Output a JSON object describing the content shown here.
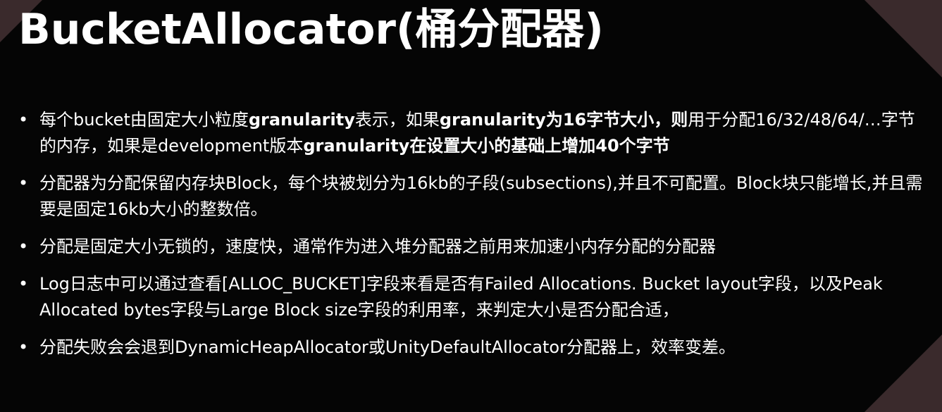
{
  "title": "BucketAllocator(桶分配器)",
  "bullets": [
    {
      "segments": [
        {
          "text": "每个bucket由固定大小粒度",
          "bold": false
        },
        {
          "text": "granularity",
          "bold": true
        },
        {
          "text": "表示，如果",
          "bold": false
        },
        {
          "text": "granularity为16字节大小，则",
          "bold": true
        },
        {
          "text": "用于分配16/32/48/64/…字节的内存，如果是development版本",
          "bold": false
        },
        {
          "text": "granularity在设置大小的基础上增加40个字节",
          "bold": true
        }
      ]
    },
    {
      "segments": [
        {
          "text": "分配器为分配保留内存块Block，每个块被划分为16kb的子段(subsections),并且不可配置。Block块只能增长,并且需要是固定16kb大小的整数倍。",
          "bold": false
        }
      ]
    },
    {
      "segments": [
        {
          "text": "分配是固定大小无锁的，速度快，通常作为进入堆分配器之前用来加速小内存分配的分配器",
          "bold": false
        }
      ]
    },
    {
      "segments": [
        {
          "text": "Log日志中可以通过查看[ALLOC_BUCKET]字段来看是否有Failed Allocations. Bucket layout字段，以及Peak Allocated bytes字段与Large Block size字段的利用率，来判定大小是否分配合适，",
          "bold": false
        }
      ]
    },
    {
      "segments": [
        {
          "text": "分配失败会会退到DynamicHeapAllocator或UnityDefaultAllocator分配器上，效率变差。",
          "bold": false
        }
      ]
    }
  ],
  "bullet_symbol": "•",
  "colors": {
    "background": "#050505",
    "text": "#ffffff",
    "corner_accent": "#3a2a2c"
  }
}
